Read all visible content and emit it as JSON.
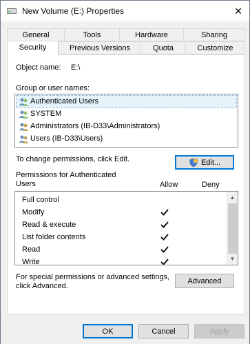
{
  "window": {
    "title": "New Volume (E:) Properties",
    "close_glyph": "✕"
  },
  "tabs": {
    "row1": [
      "General",
      "Tools",
      "Hardware",
      "Sharing"
    ],
    "row2": [
      "Security",
      "Previous Versions",
      "Quota",
      "Customize"
    ],
    "active": "Security"
  },
  "security": {
    "object_name_label": "Object name:",
    "object_name_value": "E:\\",
    "group_label": "Group or user names:",
    "users": [
      "Authenticated Users",
      "SYSTEM",
      "Administrators (IB-D33\\Administrators)",
      "Users (IB-D33\\Users)"
    ],
    "selected_user": "Authenticated Users",
    "change_text": "To change permissions, click Edit.",
    "edit_label": "Edit...",
    "permissions_label": "Permissions for Authenticated Users",
    "allow_header": "Allow",
    "deny_header": "Deny",
    "permissions": [
      {
        "name": "Full control",
        "allow": false,
        "deny": false
      },
      {
        "name": "Modify",
        "allow": true,
        "deny": false
      },
      {
        "name": "Read & execute",
        "allow": true,
        "deny": false
      },
      {
        "name": "List folder contents",
        "allow": true,
        "deny": false
      },
      {
        "name": "Read",
        "allow": true,
        "deny": false
      },
      {
        "name": "Write",
        "allow": true,
        "deny": false
      }
    ],
    "special_text": "For special permissions or advanced settings, click Advanced.",
    "advanced_label": "Advanced"
  },
  "footer": {
    "ok_label": "OK",
    "cancel_label": "Cancel",
    "apply_label": "Apply"
  },
  "colors": {
    "accent": "#0078d7",
    "selection": "#e5f3fb"
  }
}
